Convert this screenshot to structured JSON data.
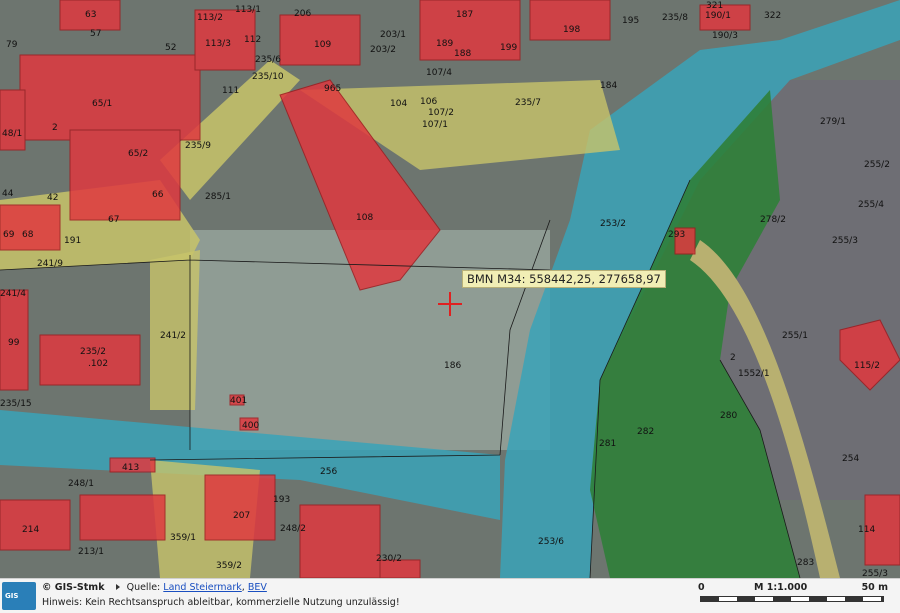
{
  "map": {
    "coordinate_label": "BMN M34: 558442,25, 277658,97",
    "parcels": [
      "63",
      "79",
      "57",
      "52",
      "113/2",
      "113/3",
      "112",
      "113/1",
      "206",
      "109",
      "203/1",
      "203/2",
      "187",
      "188",
      "189",
      "199",
      "198",
      "195",
      "235/8",
      "321",
      "190/1",
      "190/3",
      "322",
      "235/6",
      "235/10",
      "111",
      "965",
      "107/4",
      "104",
      "106",
      "107/2",
      "107/1",
      "235/7",
      "184",
      "279/1",
      "65/1",
      "48/1",
      "2",
      "65/2",
      "66",
      "235/9",
      "42",
      "67",
      "44",
      "69",
      "68",
      "191",
      "241/9",
      "285/1",
      "108",
      "253/2",
      "293",
      "278/2",
      "255/2",
      "255/4",
      "255/3",
      "241/4",
      "99",
      "235/2",
      ".102",
      "241/2",
      "186",
      "255/1",
      "115/2",
      "2",
      "1552/1",
      "235/15",
      "401",
      "400",
      "281",
      "282",
      "280",
      "254",
      "413",
      "248/1",
      "256",
      "193",
      "207",
      "214",
      "248/2",
      "359/1",
      "213/1",
      "253/6",
      "230/2",
      "359/2",
      "283",
      "114",
      "255/3"
    ]
  },
  "footer": {
    "logo_text": "GIS",
    "brand": "© GIS-Stmk",
    "source_label": "Quelle:",
    "source_link_1": "Land Steiermark",
    "source_sep": ", ",
    "source_link_2": "BEV",
    "notice": "Hinweis: Kein Rechtsanspruch ableitbar, kommerzielle Nutzung unzulässig!",
    "scale_zero": "0",
    "scale_ratio": "M 1:1.000",
    "scale_end": "50 m"
  },
  "colors": {
    "building": "#e0393f",
    "road": "#c8c46a",
    "water": "#2fa0b8",
    "forest": "#2c8a3a",
    "ground": "#7d8a80"
  }
}
